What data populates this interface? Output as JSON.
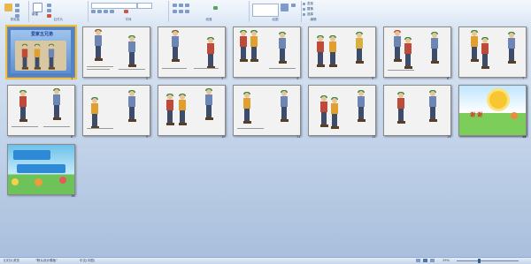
{
  "ribbon": {
    "groups": [
      {
        "label": "剪贴板"
      },
      {
        "label": "幻灯片"
      },
      {
        "label": "字体"
      },
      {
        "label": "段落"
      },
      {
        "label": "绘图"
      },
      {
        "label": "编辑"
      }
    ],
    "new_slide_label": "新建",
    "edit_items": [
      "查找",
      "替换",
      "选择"
    ]
  },
  "slides": [
    {
      "number": "1",
      "kind": "cover",
      "title": "爱家五兄弟"
    },
    {
      "number": "2",
      "kind": "story"
    },
    {
      "number": "3",
      "kind": "story"
    },
    {
      "number": "4",
      "kind": "story"
    },
    {
      "number": "5",
      "kind": "story"
    },
    {
      "number": "6",
      "kind": "story"
    },
    {
      "number": "7",
      "kind": "story"
    },
    {
      "number": "8",
      "kind": "story"
    },
    {
      "number": "9",
      "kind": "story"
    },
    {
      "number": "10",
      "kind": "story"
    },
    {
      "number": "11",
      "kind": "story"
    },
    {
      "number": "12",
      "kind": "story"
    },
    {
      "number": "13",
      "kind": "story"
    },
    {
      "number": "14",
      "kind": "text"
    },
    {
      "number": "15",
      "kind": "thanks",
      "title": "谢 谢"
    },
    {
      "number": "16",
      "kind": "summary"
    }
  ],
  "status": {
    "slide_info": "幻灯片浏览",
    "theme": "\"默认设计模板\"",
    "language": "中文(中国)",
    "zoom": "29%"
  },
  "colors": {
    "accent": "#f0c040",
    "hat": "#2f8a3a"
  }
}
